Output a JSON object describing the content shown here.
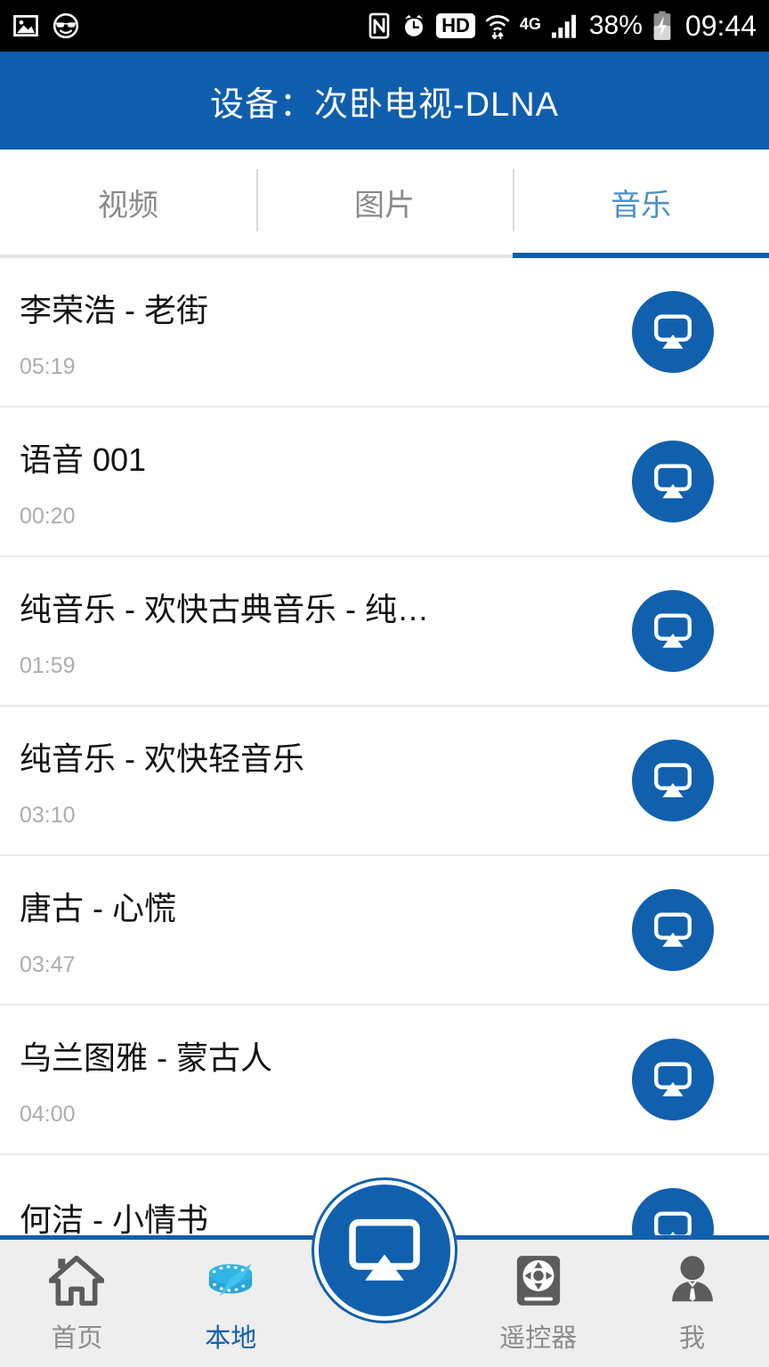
{
  "status_bar": {
    "left_icons": [
      {
        "name": "gallery-icon",
        "label": "picture"
      },
      {
        "name": "sunglasses-smiley-icon",
        "label": "smiley"
      }
    ],
    "right_icons": [
      {
        "name": "nfc-icon",
        "label": "N"
      },
      {
        "name": "alarm-clock-icon",
        "label": "alarm"
      },
      {
        "name": "hd-icon",
        "label": "HD"
      },
      {
        "name": "wifi-icon",
        "label": "wifi"
      },
      {
        "name": "network-4g-icon",
        "label": "4G"
      },
      {
        "name": "signal-bars-icon",
        "label": "signal"
      }
    ],
    "hd_label": "HD",
    "network_label": "4G",
    "battery_percent": "38%",
    "clock": "09:44"
  },
  "header": {
    "title": "设备：次卧电视-DLNA",
    "background": "#0f5eae"
  },
  "tabs": {
    "active_index": 2,
    "items": [
      {
        "label": "视频",
        "active": false
      },
      {
        "label": "图片",
        "active": false
      },
      {
        "label": "音乐",
        "active": true
      }
    ],
    "active_color": "#4a90c8",
    "inactive_color": "#8a8a8a",
    "indicator_color": "#0f5eae"
  },
  "music_list": {
    "cast_icon_name": "cast-icon",
    "cast_icon_color": "#1160ae",
    "items": [
      {
        "title": "李荣浩 - 老街",
        "duration": "05:19"
      },
      {
        "title": "语音 001",
        "duration": "00:20"
      },
      {
        "title": "纯音乐 - 欢快古典音乐 - 纯…",
        "duration": "01:59"
      },
      {
        "title": "纯音乐 - 欢快轻音乐",
        "duration": "03:10"
      },
      {
        "title": "唐古 - 心慌",
        "duration": "03:47"
      },
      {
        "title": "乌兰图雅 - 蒙古人",
        "duration": "04:00"
      },
      {
        "title": "何洁 - 小情书",
        "duration": ""
      }
    ]
  },
  "bottom_nav": {
    "active_index": 1,
    "accent_color": "#1160ae",
    "items": [
      {
        "label": "首页",
        "icon": "home-icon",
        "active": false
      },
      {
        "label": "本地",
        "icon": "film-strip-icon",
        "active": true
      },
      {
        "label": "遥控器",
        "icon": "remote-control-icon",
        "active": false
      },
      {
        "label": "我",
        "icon": "user-profile-icon",
        "active": false
      }
    ],
    "fab": {
      "name": "cast-fab-button",
      "icon": "cast-icon"
    }
  }
}
